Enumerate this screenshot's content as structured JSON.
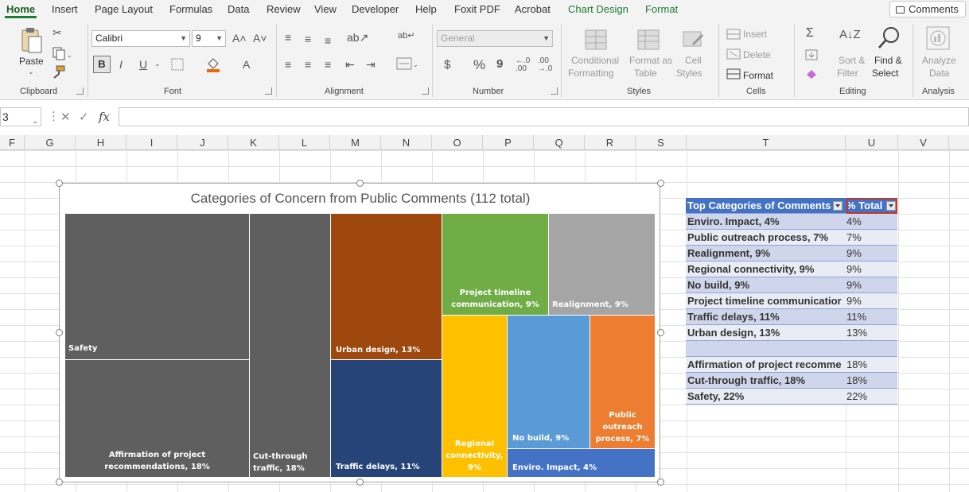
{
  "ribbon_tabs": [
    "Home",
    "Insert",
    "Page Layout",
    "Formulas",
    "Data",
    "Review",
    "View",
    "Developer",
    "Help",
    "Foxit PDF",
    "Acrobat",
    "Chart Design",
    "Format"
  ],
  "comments_label": "Comments",
  "clipboard": {
    "paste": "Paste",
    "group": "Clipboard"
  },
  "font": {
    "name": "Calibri",
    "size": "9",
    "bold": "B",
    "italic": "I",
    "underline": "U",
    "group": "Font"
  },
  "alignment": {
    "group": "Alignment"
  },
  "number": {
    "format": "General",
    "currency": "$",
    "percent": "%",
    "comma": "9",
    "group": "Number"
  },
  "styles": {
    "conditional": "Conditional",
    "formatting": "Formatting",
    "format_as": "Format as",
    "table": "Table",
    "cell": "Cell",
    "cell_styles": "Styles",
    "group": "Styles"
  },
  "cells": {
    "insert": "Insert",
    "delete": "Delete",
    "format": "Format",
    "group": "Cells"
  },
  "editing": {
    "sort": "Sort &",
    "filter": "Filter",
    "find": "Find &",
    "select": "Select",
    "group": "Editing"
  },
  "analysis": {
    "analyze": "Analyze",
    "data": "Data",
    "group": "Analysis"
  },
  "formula_bar": {
    "name_box": "3",
    "fx": "fx",
    "value": ""
  },
  "columns": [
    "F",
    "G",
    "H",
    "I",
    "J",
    "K",
    "L",
    "M",
    "N",
    "O",
    "P",
    "Q",
    "R",
    "S",
    "T",
    "U",
    "V"
  ],
  "chart_data": {
    "type": "treemap",
    "title": "Categories of Concern from Public Comments (112 total)",
    "tiles": [
      {
        "label": "Safety",
        "value": 22,
        "color": "#5f5f5f"
      },
      {
        "label": "Affirmation of project recommendations, 18%",
        "value": 18,
        "color": "#5f5f5f"
      },
      {
        "label": "Cut-through traffic, 18%",
        "value": 18,
        "color": "#5f5f5f"
      },
      {
        "label": "Urban design, 13%",
        "value": 13,
        "color": "#9e480e"
      },
      {
        "label": "Traffic delays, 11%",
        "value": 11,
        "color": "#264478"
      },
      {
        "label": "Project timeline communication, 9%",
        "value": 9,
        "color": "#70ad47"
      },
      {
        "label": "Realignment, 9%",
        "value": 9,
        "color": "#a5a5a5"
      },
      {
        "label": "Regional connectivity, 9%",
        "value": 9,
        "color": "#ffc000"
      },
      {
        "label": "No build, 9%",
        "value": 9,
        "color": "#5b9bd5"
      },
      {
        "label": "Public outreach process, 7%",
        "value": 7,
        "color": "#ed7d31"
      },
      {
        "label": "Enviro. Impact, 4%",
        "value": 4,
        "color": "#4472c4"
      }
    ]
  },
  "table": {
    "headers": [
      "Top Categories of Comments",
      "% Total"
    ],
    "rows": [
      [
        "Enviro. Impact, 4%",
        "4%"
      ],
      [
        "Public outreach process, 7%",
        "7%"
      ],
      [
        "Realignment, 9%",
        "9%"
      ],
      [
        "Regional connectivity, 9%",
        "9%"
      ],
      [
        "No build, 9%",
        "9%"
      ],
      [
        "Project timeline communicatior",
        "9%"
      ],
      [
        "Traffic delays, 11%",
        "11%"
      ],
      [
        "Urban design, 13%",
        "13%"
      ],
      [
        "",
        ""
      ],
      [
        "Affirmation of project recomme",
        "18%"
      ],
      [
        "Cut-through traffic, 18%",
        "18%"
      ],
      [
        "Safety, 22%",
        "22%"
      ]
    ]
  }
}
